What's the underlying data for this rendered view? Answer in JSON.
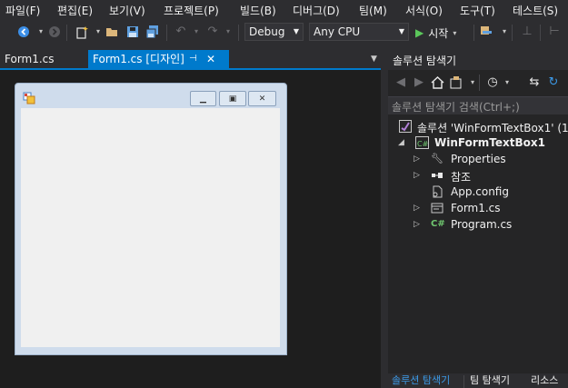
{
  "menu": {
    "file": "파일(F)",
    "edit": "편집(E)",
    "view": "보기(V)",
    "project": "프로젝트(P)",
    "build": "빌드(B)",
    "debug": "디버그(D)",
    "team": "팀(M)",
    "format": "서식(O)",
    "tools": "도구(T)",
    "test": "테스트(S)"
  },
  "toolbar": {
    "config_value": "Debug",
    "platform_value": "Any CPU",
    "start_label": "시작"
  },
  "editor": {
    "tabs": [
      {
        "label": "Form1.cs"
      },
      {
        "label": "Form1.cs [디자인]"
      }
    ]
  },
  "solution_explorer": {
    "title": "솔루션 탐색기",
    "search_placeholder": "솔루션 탐색기 검색(Ctrl+;)",
    "solution_label": "솔루션 'WinFormTextBox1' (1",
    "project_label": "WinFormTextBox1",
    "items": [
      {
        "label": "Properties",
        "icon": "wrench-icon"
      },
      {
        "label": "참조",
        "icon": "references-icon"
      },
      {
        "label": "App.config",
        "icon": "config-file-icon"
      },
      {
        "label": "Form1.cs",
        "icon": "form-icon"
      },
      {
        "label": "Program.cs",
        "icon": "csharp-file-icon"
      }
    ],
    "bottom_tabs": [
      {
        "label": "솔루션 탐색기"
      },
      {
        "label": "팀 탐색기"
      },
      {
        "label": "리소스"
      }
    ]
  },
  "colors": {
    "accent": "#007acc",
    "background": "#2d2d30",
    "designer_bg": "#1e1e1e",
    "form_client": "#f0f0f0"
  }
}
